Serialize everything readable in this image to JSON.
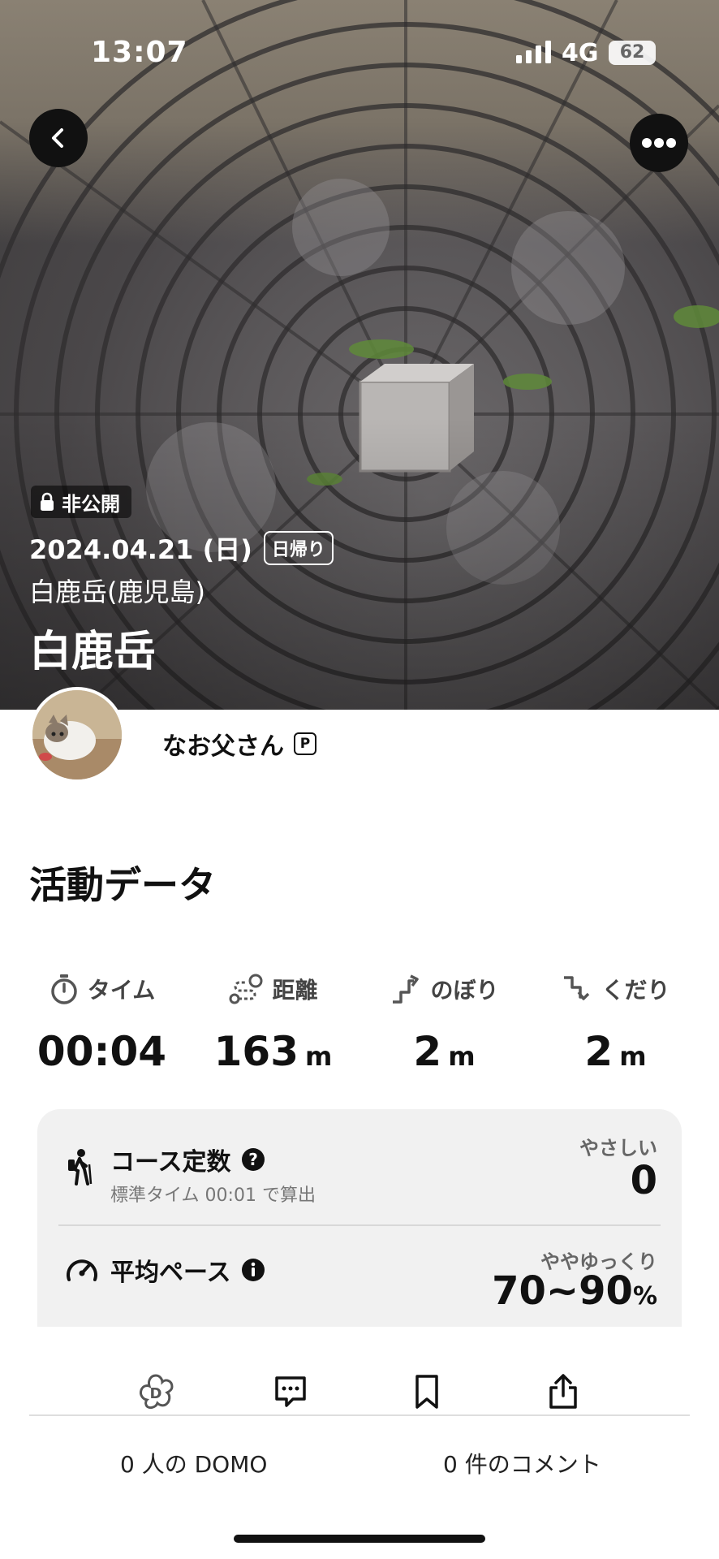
{
  "status_bar": {
    "time": "13:07",
    "network": "4G",
    "battery": "62"
  },
  "hero": {
    "privacy": "非公開",
    "date": "2024.04.21 (日)",
    "trip_type": "日帰り",
    "area": "白鹿岳(鹿児島)",
    "mountain": "白鹿岳"
  },
  "user": {
    "name": "なお父さん",
    "badge": "P"
  },
  "activity": {
    "title": "活動データ",
    "stats": [
      {
        "label": "タイム",
        "value": "00:04",
        "unit": ""
      },
      {
        "label": "距離",
        "value": "163",
        "unit": "m"
      },
      {
        "label": "のぼり",
        "value": "2",
        "unit": "m"
      },
      {
        "label": "くだり",
        "value": "2",
        "unit": "m"
      }
    ],
    "course": {
      "title": "コース定数",
      "sub": "標準タイム 00:01 で算出",
      "level": "やさしい",
      "value": "0"
    },
    "pace": {
      "title": "平均ペース",
      "level": "ややゆっくり",
      "value": "70~90",
      "unit": "%"
    }
  },
  "footer": {
    "domo": "0 人の DOMO",
    "comments": "0 件のコメント"
  }
}
